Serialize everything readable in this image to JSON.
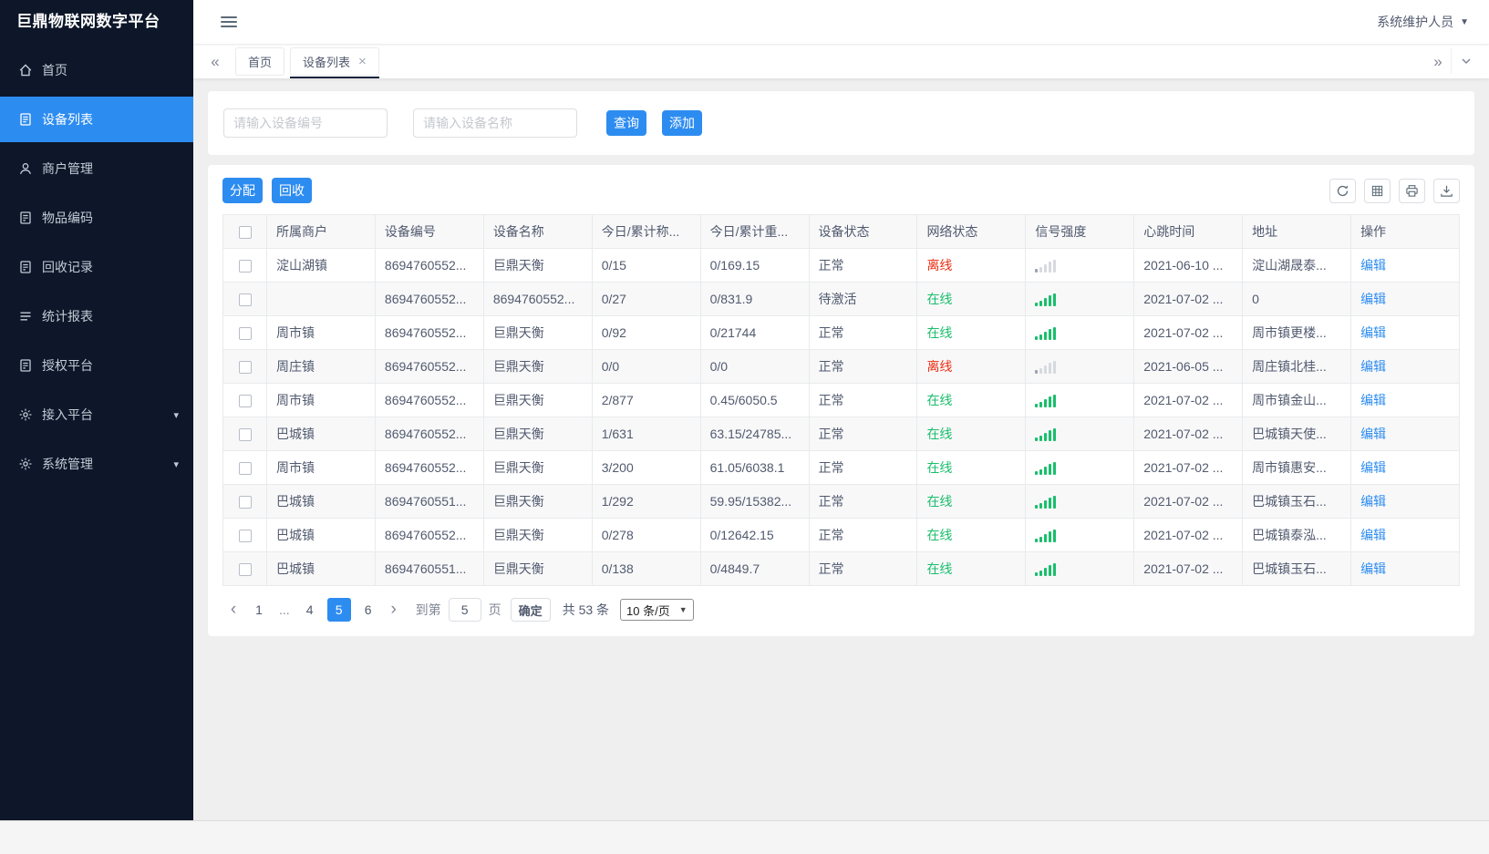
{
  "app": {
    "title": "巨鼎物联网数字平台",
    "user": "系统维护人员"
  },
  "sidebar": {
    "items": [
      {
        "id": "home",
        "label": "首页",
        "icon": "home-icon",
        "active": false,
        "expandable": false
      },
      {
        "id": "device-list",
        "label": "设备列表",
        "icon": "device-list-icon",
        "active": true,
        "expandable": false
      },
      {
        "id": "merchant-management",
        "label": "商户管理",
        "icon": "user-icon",
        "active": false,
        "expandable": false
      },
      {
        "id": "item-coding",
        "label": "物品编码",
        "icon": "doc-icon",
        "active": false,
        "expandable": false
      },
      {
        "id": "recycle-records",
        "label": "回收记录",
        "icon": "doc-icon",
        "active": false,
        "expandable": false
      },
      {
        "id": "statistics-report",
        "label": "统计报表",
        "icon": "report-icon",
        "active": false,
        "expandable": false
      },
      {
        "id": "authorization-platform",
        "label": "授权平台",
        "icon": "doc-icon",
        "active": false,
        "expandable": false
      },
      {
        "id": "access-platform",
        "label": "接入平台",
        "icon": "gear-icon",
        "active": false,
        "expandable": true
      },
      {
        "id": "system-management",
        "label": "系统管理",
        "icon": "gear-icon",
        "active": false,
        "expandable": true
      }
    ]
  },
  "tabs": [
    {
      "id": "home",
      "label": "首页",
      "active": false,
      "closable": false
    },
    {
      "id": "device-list",
      "label": "设备列表",
      "active": true,
      "closable": true
    }
  ],
  "search": {
    "device_no_placeholder": "请输入设备编号",
    "device_name_placeholder": "请输入设备名称",
    "query_label": "查询",
    "add_label": "添加"
  },
  "toolbar": {
    "assign_label": "分配",
    "recycle_label": "回收"
  },
  "table": {
    "headers": [
      "所属商户",
      "设备编号",
      "设备名称",
      "今日/累计称...",
      "今日/累计重...",
      "设备状态",
      "网络状态",
      "信号强度",
      "心跳时间",
      "地址",
      "操作"
    ],
    "rows": [
      {
        "merchant": "淀山湖镇",
        "device_no": "8694760552...",
        "device_name": "巨鼎天衡",
        "weigh_count": "0/15",
        "weight": "0/169.15",
        "status": "正常",
        "network": "离线",
        "online": false,
        "signal": "weak",
        "heartbeat": "2021-06-10 ...",
        "address": "淀山湖晟泰...",
        "action": "编辑"
      },
      {
        "merchant": "",
        "device_no": "8694760552...",
        "device_name": "8694760552...",
        "weigh_count": "0/27",
        "weight": "0/831.9",
        "status": "待激活",
        "network": "在线",
        "online": true,
        "signal": "strong",
        "heartbeat": "2021-07-02 ...",
        "address": "0",
        "action": "编辑"
      },
      {
        "merchant": "周市镇",
        "device_no": "8694760552...",
        "device_name": "巨鼎天衡",
        "weigh_count": "0/92",
        "weight": "0/21744",
        "status": "正常",
        "network": "在线",
        "online": true,
        "signal": "strong",
        "heartbeat": "2021-07-02 ...",
        "address": "周市镇更楼...",
        "action": "编辑"
      },
      {
        "merchant": "周庄镇",
        "device_no": "8694760552...",
        "device_name": "巨鼎天衡",
        "weigh_count": "0/0",
        "weight": "0/0",
        "status": "正常",
        "network": "离线",
        "online": false,
        "signal": "weak",
        "heartbeat": "2021-06-05 ...",
        "address": "周庄镇北桂...",
        "action": "编辑"
      },
      {
        "merchant": "周市镇",
        "device_no": "8694760552...",
        "device_name": "巨鼎天衡",
        "weigh_count": "2/877",
        "weight": "0.45/6050.5",
        "status": "正常",
        "network": "在线",
        "online": true,
        "signal": "strong",
        "heartbeat": "2021-07-02 ...",
        "address": "周市镇金山...",
        "action": "编辑"
      },
      {
        "merchant": "巴城镇",
        "device_no": "8694760552...",
        "device_name": "巨鼎天衡",
        "weigh_count": "1/631",
        "weight": "63.15/24785...",
        "status": "正常",
        "network": "在线",
        "online": true,
        "signal": "strong",
        "heartbeat": "2021-07-02 ...",
        "address": "巴城镇天使...",
        "action": "编辑"
      },
      {
        "merchant": "周市镇",
        "device_no": "8694760552...",
        "device_name": "巨鼎天衡",
        "weigh_count": "3/200",
        "weight": "61.05/6038.1",
        "status": "正常",
        "network": "在线",
        "online": true,
        "signal": "strong",
        "heartbeat": "2021-07-02 ...",
        "address": "周市镇惠安...",
        "action": "编辑"
      },
      {
        "merchant": "巴城镇",
        "device_no": "8694760551...",
        "device_name": "巨鼎天衡",
        "weigh_count": "1/292",
        "weight": "59.95/15382...",
        "status": "正常",
        "network": "在线",
        "online": true,
        "signal": "strong",
        "heartbeat": "2021-07-02 ...",
        "address": "巴城镇玉石...",
        "action": "编辑"
      },
      {
        "merchant": "巴城镇",
        "device_no": "8694760552...",
        "device_name": "巨鼎天衡",
        "weigh_count": "0/278",
        "weight": "0/12642.15",
        "status": "正常",
        "network": "在线",
        "online": true,
        "signal": "strong",
        "heartbeat": "2021-07-02 ...",
        "address": "巴城镇泰泓...",
        "action": "编辑"
      },
      {
        "merchant": "巴城镇",
        "device_no": "8694760551...",
        "device_name": "巨鼎天衡",
        "weigh_count": "0/138",
        "weight": "0/4849.7",
        "status": "正常",
        "network": "在线",
        "online": true,
        "signal": "strong",
        "heartbeat": "2021-07-02 ...",
        "address": "巴城镇玉石...",
        "action": "编辑"
      }
    ]
  },
  "pagination": {
    "pages": [
      "1",
      "...",
      "4",
      "5",
      "6"
    ],
    "active_page": "5",
    "goto_label": "到第",
    "goto_value": "5",
    "goto_unit": "页",
    "confirm_label": "确定",
    "total_label": "共 53 条",
    "page_size_label": "10 条/页"
  },
  "colors": {
    "primary": "#2d8cf0",
    "online": "#19be6b",
    "offline": "#ed3014",
    "sidebar_bg": "#0d1729"
  }
}
